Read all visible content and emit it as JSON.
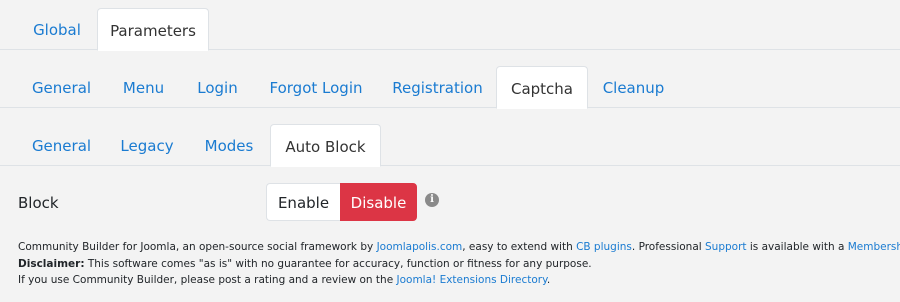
{
  "tabs_level1": {
    "global": "Global",
    "parameters": "Parameters"
  },
  "tabs_level2": {
    "general": "General",
    "menu": "Menu",
    "login": "Login",
    "forgot_login": "Forgot Login",
    "registration": "Registration",
    "captcha": "Captcha",
    "cleanup": "Cleanup"
  },
  "tabs_level3": {
    "general": "General",
    "legacy": "Legacy",
    "modes": "Modes",
    "auto_block": "Auto Block"
  },
  "block_field": {
    "label": "Block",
    "enable_label": "Enable",
    "disable_label": "Disable",
    "selected": "Disable",
    "info_icon_glyph": "i"
  },
  "footer": {
    "line1_part1": "Community Builder for Joomla, an open-source social framework by ",
    "link_joomlapolis": "Joomlapolis.com",
    "line1_part2": ", easy to extend with ",
    "link_cb_plugins": "CB plugins",
    "line1_part3": ". Professional ",
    "link_support": "Support",
    "line1_part4": " is available with a ",
    "link_membership": "Membership",
    "line1_part5": ".",
    "disclaimer_label": "Disclaimer:",
    "disclaimer_text": " This software comes \"as is\" with no guarantee for accuracy, function or fitness for any purpose.",
    "line3_part1": "If you use Community Builder, please post a rating and a review on the ",
    "link_jed": "Joomla! Extensions Directory",
    "line3_part2": "."
  },
  "colors": {
    "link": "#1a7bd1",
    "danger": "#dc3545",
    "background": "#f3f3f3"
  }
}
